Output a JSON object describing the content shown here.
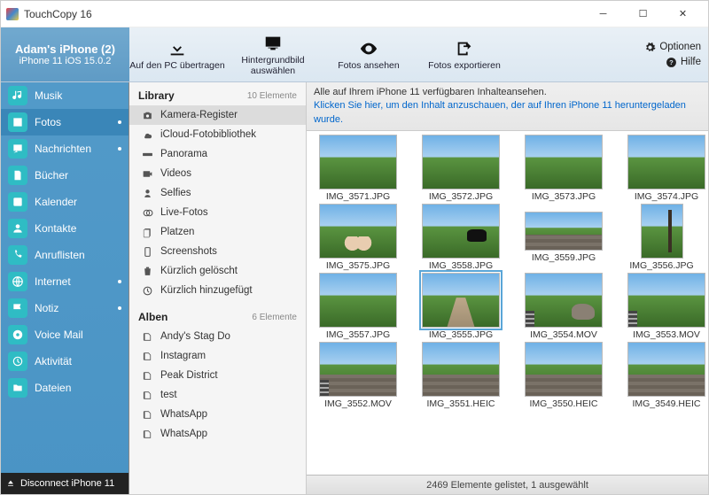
{
  "title": "TouchCopy 16",
  "device": {
    "name": "Adam's iPhone (2)",
    "model": "iPhone 11 iOS 15.0.2"
  },
  "toolbar": {
    "transfer": "Auf den PC übertragen",
    "wallpaper": "Hintergrundbild auswählen",
    "view": "Fotos ansehen",
    "export": "Fotos exportieren"
  },
  "top_right": {
    "options": "Optionen",
    "help": "Hilfe"
  },
  "sidebar": {
    "items": [
      {
        "label": "Musik",
        "dot": false
      },
      {
        "label": "Fotos",
        "dot": true,
        "active": true
      },
      {
        "label": "Nachrichten",
        "dot": true
      },
      {
        "label": "Bücher",
        "dot": false
      },
      {
        "label": "Kalender",
        "dot": false
      },
      {
        "label": "Kontakte",
        "dot": false
      },
      {
        "label": "Anruflisten",
        "dot": false
      },
      {
        "label": "Internet",
        "dot": true
      },
      {
        "label": "Notiz",
        "dot": true
      },
      {
        "label": "Voice Mail",
        "dot": false
      },
      {
        "label": "Aktivität",
        "dot": false
      },
      {
        "label": "Dateien",
        "dot": false
      }
    ],
    "disconnect": "Disconnect iPhone 11"
  },
  "library": {
    "header1": "Library",
    "count1": "10 Elemente",
    "list1": [
      "Kamera-Register",
      "iCloud-Fotobibliothek",
      "Panorama",
      "Videos",
      "Selfies",
      "Live-Fotos",
      "Platzen",
      "Screenshots",
      "Kürzlich gelöscht",
      "Kürzlich hinzugefügt"
    ],
    "header2": "Alben",
    "count2": "6 Elemente",
    "list2": [
      "Andy's Stag Do",
      "Instagram",
      "Peak District",
      "test",
      "WhatsApp",
      "WhatsApp"
    ]
  },
  "info": {
    "line1": "Alle auf Ihrem iPhone 11 verfügbaren Inhalteansehen.",
    "line2": "Klicken Sie hier, um den Inhalt anzuschauen, der auf Ihren iPhone 11 heruntergeladen wurde."
  },
  "thumbs": [
    [
      {
        "label": "IMG_3571.JPG"
      },
      {
        "label": "IMG_3572.JPG"
      },
      {
        "label": "IMG_3573.JPG"
      },
      {
        "label": "IMG_3574.JPG"
      }
    ],
    [
      {
        "label": "IMG_3575.JPG",
        "feet": true
      },
      {
        "label": "IMG_3558.JPG",
        "cow": true
      },
      {
        "label": "IMG_3559.JPG",
        "wide": true,
        "wall": true
      },
      {
        "label": "IMG_3556.JPG",
        "portrait": true,
        "post": true
      }
    ],
    [
      {
        "label": "IMG_3557.JPG"
      },
      {
        "label": "IMG_3555.JPG",
        "selected": true,
        "path": true
      },
      {
        "label": "IMG_3554.MOV",
        "mov": true,
        "rock": true
      },
      {
        "label": "IMG_3553.MOV",
        "mov": true
      }
    ],
    [
      {
        "label": "IMG_3552.MOV",
        "mov": true,
        "wall": true
      },
      {
        "label": "IMG_3551.HEIC",
        "wall": true
      },
      {
        "label": "IMG_3550.HEIC",
        "wall": true
      },
      {
        "label": "IMG_3549.HEIC",
        "wall": true
      }
    ]
  ],
  "status": "2469 Elemente gelistet, 1 ausgewählt"
}
